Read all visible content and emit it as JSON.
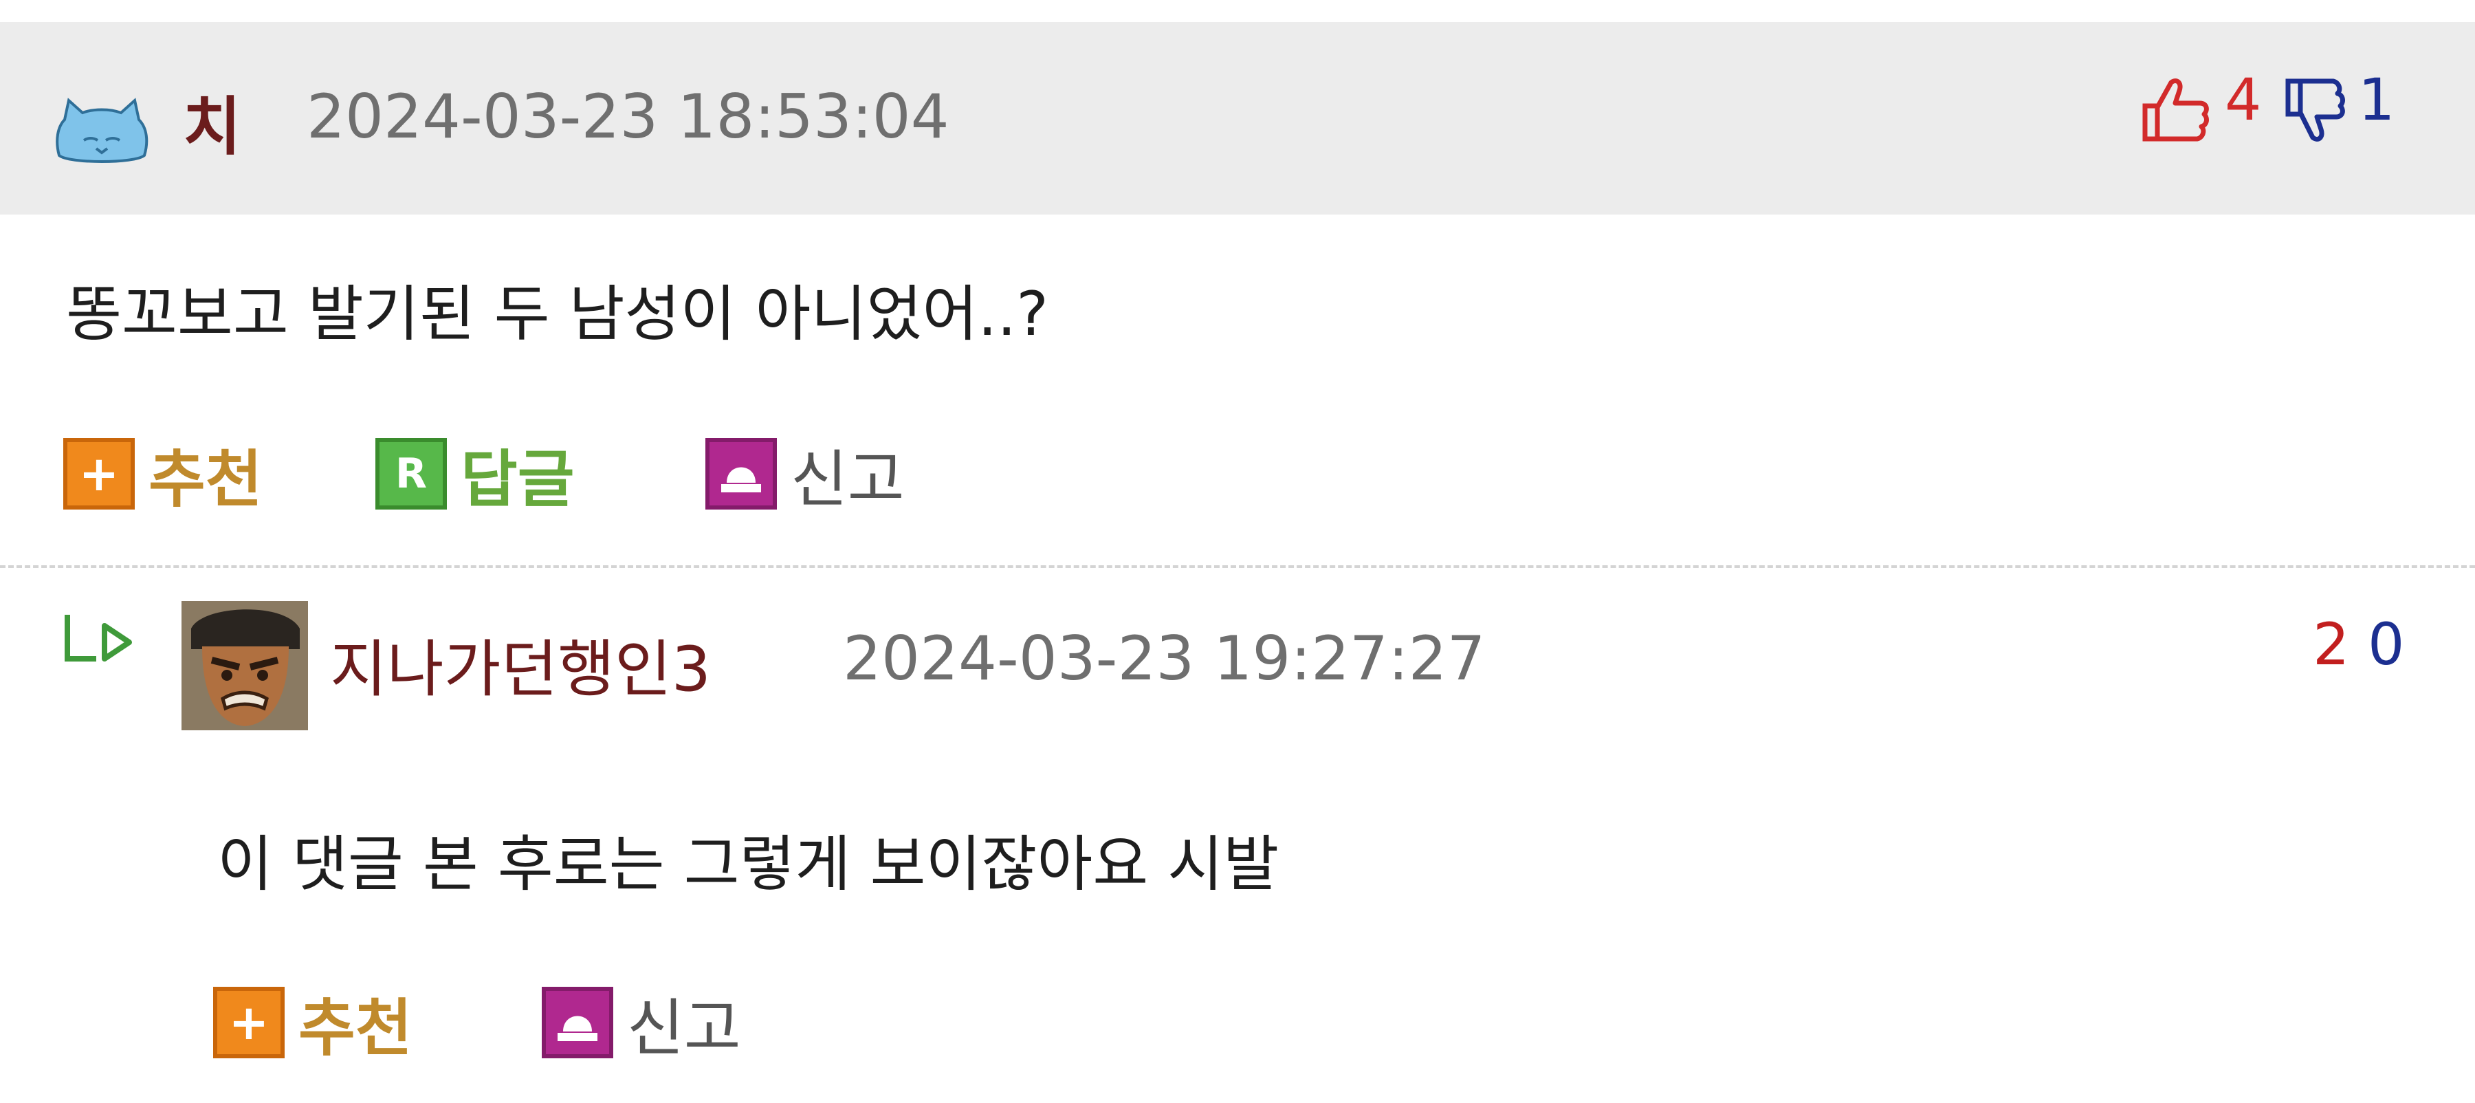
{
  "comments": [
    {
      "nickname": "치",
      "timestamp": "2024-03-23 18:53:04",
      "text": "똥꼬보고 발기된 두 남성이 아니었어..?",
      "upvotes": "4",
      "downvotes": "1",
      "actions": {
        "recommend": "추천",
        "reply": "답글",
        "report": "신고"
      },
      "avatar_icon": "cat-avatar-icon"
    }
  ],
  "reply": {
    "nickname": "지나가던행인3",
    "timestamp": "2024-03-23 19:27:27",
    "text": "이 댓글 본 후로는 그렇게 보이잖아요 시발",
    "upvotes": "2",
    "downvotes": "0",
    "actions": {
      "recommend": "추천",
      "report": "신고"
    },
    "avatar_icon": "face-avatar-icon",
    "reply_indicator_icon": "reply-arrow-icon"
  },
  "colors": {
    "header_bg": "#ececec",
    "nickname": "#6b1c1c",
    "upvote": "#d22a2a",
    "downvote": "#1c2f90",
    "recommend": "#c08a2c",
    "reply": "#66a83c"
  }
}
